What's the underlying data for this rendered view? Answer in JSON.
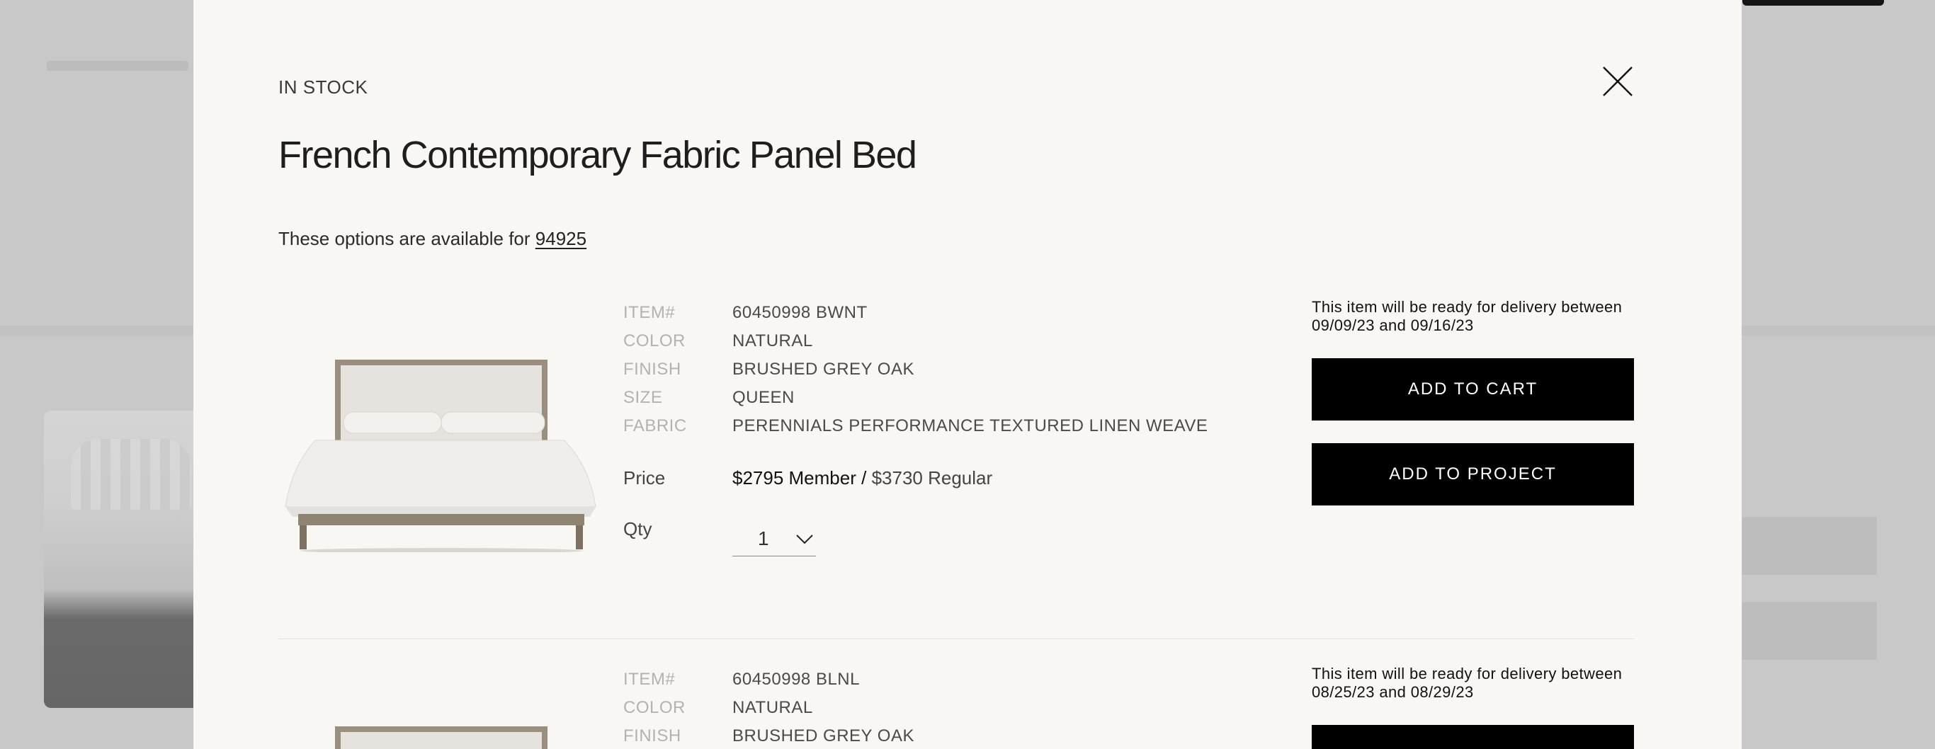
{
  "modal": {
    "stock_status": "IN STOCK",
    "title": "French Contemporary Fabric Panel Bed",
    "availability_text": "These options are available for ",
    "zip_code": "94925",
    "close_icon": "close-icon"
  },
  "items": [
    {
      "specs": [
        {
          "label": "ITEM#",
          "value": "60450998 BWNT"
        },
        {
          "label": "COLOR",
          "value": "NATURAL"
        },
        {
          "label": "FINISH",
          "value": "BRUSHED GREY OAK"
        },
        {
          "label": "SIZE",
          "value": "QUEEN"
        },
        {
          "label": "FABRIC",
          "value": "PERENNIALS PERFORMANCE TEXTURED LINEN WEAVE"
        }
      ],
      "price_label": "Price",
      "member_price": "$2795 Member /",
      "regular_price": "$3730 Regular",
      "qty_label": "Qty",
      "qty_value": "1",
      "delivery_text": "This item will be ready for delivery between 09/09/23 and 09/16/23",
      "add_to_cart_label": "ADD TO CART",
      "add_to_project_label": "ADD TO PROJECT"
    },
    {
      "specs": [
        {
          "label": "ITEM#",
          "value": "60450998 BLNL"
        },
        {
          "label": "COLOR",
          "value": "NATURAL"
        },
        {
          "label": "FINISH",
          "value": "BRUSHED GREY OAK"
        }
      ],
      "delivery_text": "This item will be ready for delivery between 08/25/23 and 08/29/23"
    }
  ]
}
